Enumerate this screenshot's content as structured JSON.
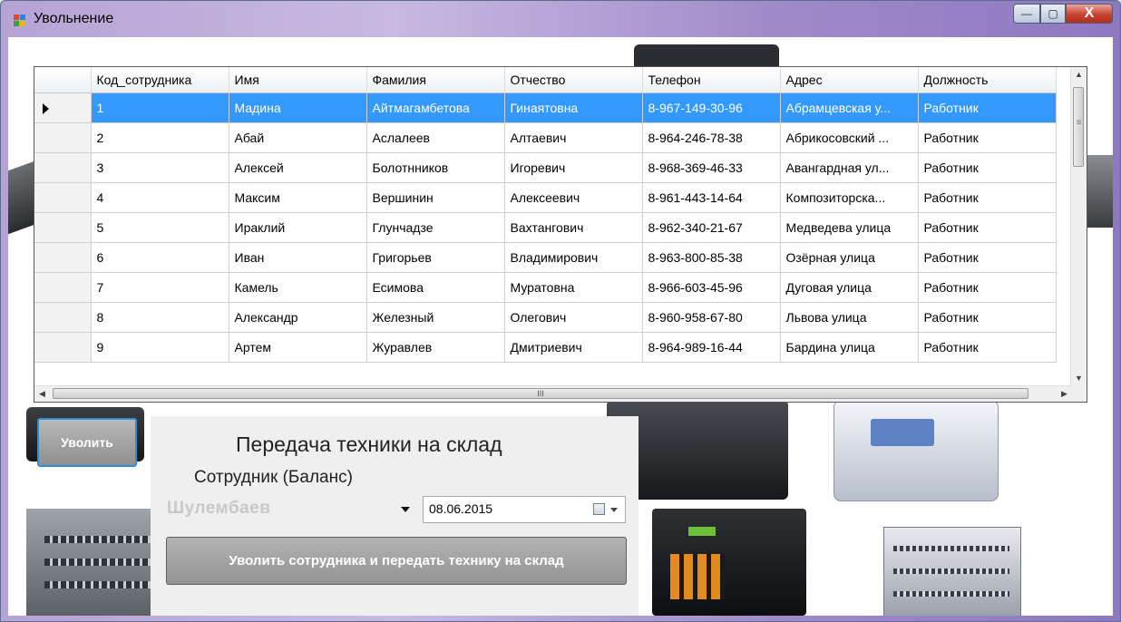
{
  "window": {
    "title": "Увольнение",
    "min_glyph": "—",
    "max_glyph": "▢",
    "close_glyph": "X"
  },
  "grid": {
    "columns": [
      "Код_сотрудника",
      "Имя",
      "Фамилия",
      "Отчество",
      "Телефон",
      "Адрес",
      "Должность"
    ],
    "rows": [
      [
        "1",
        "Мадина",
        "Айтмагамбетова",
        "Гинаятовна",
        "8-967-149-30-96",
        "Абрамцевская у...",
        "Работник"
      ],
      [
        "2",
        "Абай",
        "Аслалеев",
        "Алтаевич",
        "8-964-246-78-38",
        "Абрикосовский ...",
        "Работник"
      ],
      [
        "3",
        "Алексей",
        "Болотнников",
        "Игоревич",
        "8-968-369-46-33",
        "Авангардная ул...",
        "Работник"
      ],
      [
        "4",
        "Максим",
        "Вершинин",
        "Алексеевич",
        "8-961-443-14-64",
        "Композиторска...",
        "Работник"
      ],
      [
        "5",
        "Ираклий",
        "Глунчадзе",
        "Вахтангович",
        "8-962-340-21-67",
        "Медведева улица",
        "Работник"
      ],
      [
        "6",
        "Иван",
        "Григорьев",
        "Владимирович",
        "8-963-800-85-38",
        "Озёрная улица",
        "Работник"
      ],
      [
        "7",
        "Камель",
        "Есимова",
        "Муратовна",
        "8-966-603-45-96",
        "Дуговая улица",
        "Работник"
      ],
      [
        "8",
        "Александр",
        "Железный",
        "Олегович",
        "8-960-958-67-80",
        "Львова улица",
        "Работник"
      ],
      [
        "9",
        "Артем",
        "Журавлев",
        "Дмитриевич",
        "8-964-989-16-44",
        "Бардина улица",
        "Работник"
      ]
    ],
    "selected_row": 0,
    "hscroll_grip": "III",
    "vscroll_grip": "≡"
  },
  "fire_button": "Уволить",
  "panel": {
    "title": "Передача техники на склад",
    "subtitle": "Сотрудник (Баланс)",
    "employee_value": "Шулембаев",
    "date_value": "08.06.2015",
    "transfer_button": "Уволить сотрудника и передать технику на склад"
  },
  "colors": {
    "selection": "#3399ff",
    "title_gradient_start": "#b6a3d6",
    "title_gradient_end": "#8f78c2"
  }
}
